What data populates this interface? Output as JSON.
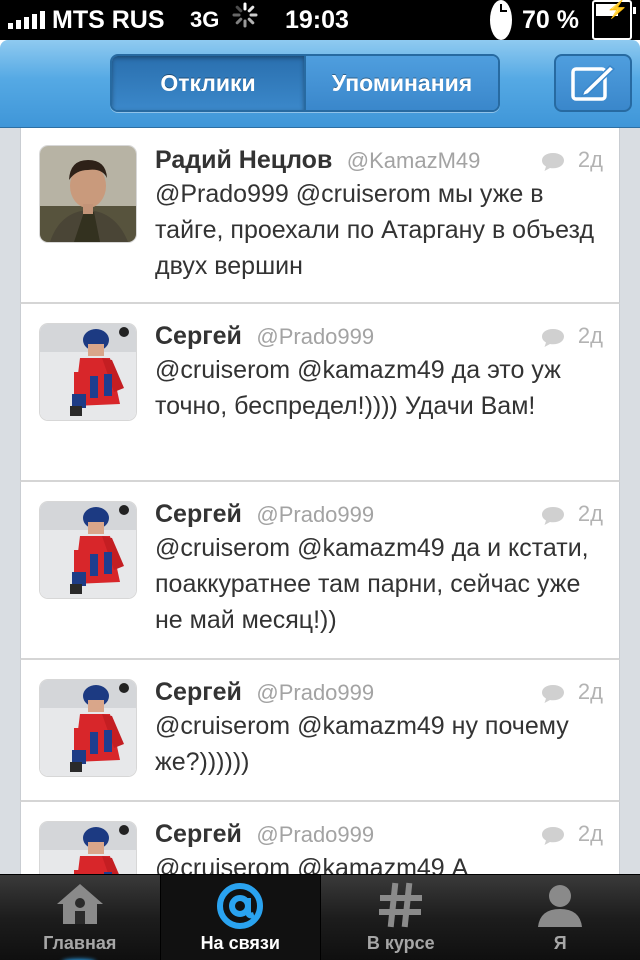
{
  "status_bar": {
    "carrier": "MTS RUS",
    "network": "3G",
    "time": "19:03",
    "battery_percent": "70 %",
    "battery_level": 0.7
  },
  "navbar": {
    "segments": [
      {
        "label": "Отклики",
        "active": true
      },
      {
        "label": "Упоминания",
        "active": false
      }
    ],
    "compose_icon": "compose-icon"
  },
  "timeline": {
    "tweets": [
      {
        "author": "Радий Нецлов",
        "handle": "@KamazM49",
        "age": "2д",
        "text": "@Prado999 @cruiserom мы уже в тайге, проехали по Атаргану в объезд двух вершин"
      },
      {
        "author": "Сергей",
        "handle": "@Prado999",
        "age": "2д",
        "text": "@cruiserom @kamazm49 да это уж точно, беспредел!)))) Удачи Вам!"
      },
      {
        "author": "Сергей",
        "handle": "@Prado999",
        "age": "2д",
        "text": "@cruiserom @kamazm49 да и кстати, поаккуратнее там парни, сейчас уже не май месяц!))"
      },
      {
        "author": "Сергей",
        "handle": "@Prado999",
        "age": "2д",
        "text": "@cruiserom @kamazm49 ну почему же?))))))"
      },
      {
        "author": "Сергей",
        "handle": "@Prado999",
        "age": "2д",
        "text": "@cruiserom @kamazm49 А"
      }
    ]
  },
  "tabbar": {
    "tabs": [
      {
        "label": "Главная",
        "icon": "home-icon",
        "active": false
      },
      {
        "label": "На связи",
        "icon": "at-sign-icon",
        "active": true
      },
      {
        "label": "В курсе",
        "icon": "hashtag-icon",
        "active": false
      },
      {
        "label": "Я",
        "icon": "profile-icon",
        "active": false
      }
    ]
  },
  "colors": {
    "nav_blue": "#3f96d8",
    "active_tab_icon": "#2aa3f0",
    "text": "#333333",
    "muted": "#a3a3a3"
  }
}
